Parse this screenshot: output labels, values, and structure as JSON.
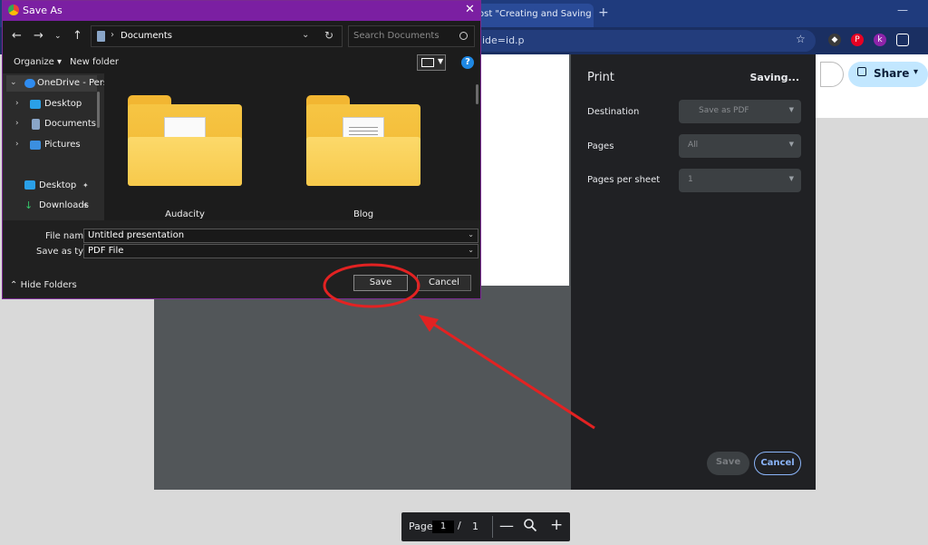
{
  "browser": {
    "tab_title": "ost \"Creating and Saving",
    "new_tab": "+",
    "minimize": "—",
    "omnibox_text": "ide=id.p",
    "star": "☆"
  },
  "extensions": [
    {
      "name": "shield",
      "color": "#2b2b2b",
      "glyph": "◆"
    },
    {
      "name": "pinterest",
      "color": "#e60023",
      "glyph": "P"
    },
    {
      "name": "k",
      "color": "#8e24aa",
      "glyph": "k"
    }
  ],
  "docs": {
    "share_label": "Share",
    "share_caret": "▾"
  },
  "print": {
    "title": "Print",
    "status": "Saving...",
    "destination_label": "Destination",
    "destination_value": "Save as PDF",
    "pages_label": "Pages",
    "pages_value": "All",
    "pages_per_sheet_label": "Pages per sheet",
    "pages_per_sheet_value": "1",
    "save": "Save",
    "cancel": "Cancel"
  },
  "page_controls": {
    "label": "Page",
    "current": "1",
    "separator": "/",
    "total": "1",
    "minus": "—",
    "plus": "+"
  },
  "dialog": {
    "title": "Save As",
    "close": "✕",
    "path_segment": "Documents",
    "search_placeholder": "Search Documents",
    "organize": "Organize ▾",
    "new_folder": "New folder",
    "help": "?",
    "nav_items": [
      {
        "label": "OneDrive - Perso"
      },
      {
        "label": "Desktop"
      },
      {
        "label": "Documents"
      },
      {
        "label": "Pictures"
      },
      {
        "label": "Desktop"
      },
      {
        "label": "Downloads"
      }
    ],
    "folders": [
      {
        "label": "Audacity"
      },
      {
        "label": "Blog"
      }
    ],
    "file_name_label": "File name:",
    "file_name_value": "Untitled presentation",
    "save_as_type_label": "Save as type:",
    "save_as_type_value": "PDF File",
    "hide_folders": "Hide Folders",
    "save": "Save",
    "cancel": "Cancel"
  },
  "colors": {
    "dialog_titlebar": "#7b1fa2",
    "annotation_red": "#e32222",
    "print_cancel_accent": "#8ab4f8"
  }
}
